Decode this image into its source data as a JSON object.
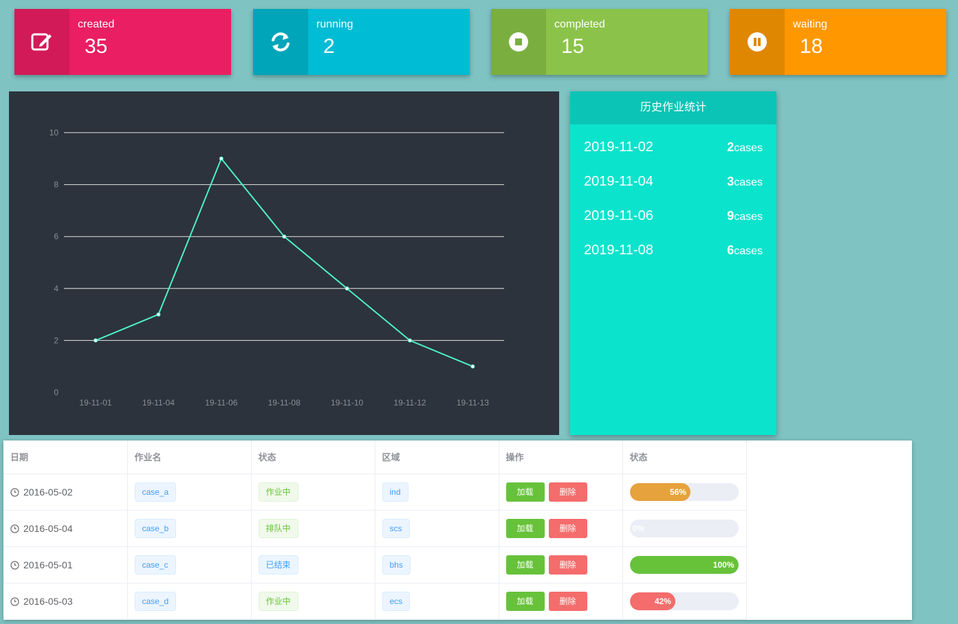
{
  "cards": [
    {
      "label": "created",
      "value": "35",
      "icon": "edit-icon",
      "color": "#ea1e63",
      "icon_bg": "#d21a58"
    },
    {
      "label": "running",
      "value": "2",
      "icon": "refresh-icon",
      "color": "#00bcd4",
      "icon_bg": "#00a5ba"
    },
    {
      "label": "completed",
      "value": "15",
      "icon": "stop-icon",
      "color": "#8bc34a",
      "icon_bg": "#7aaf40"
    },
    {
      "label": "waiting",
      "value": "18",
      "icon": "pause-icon",
      "color": "#ff9800",
      "icon_bg": "#e08700"
    }
  ],
  "chart_data": {
    "type": "line",
    "categories": [
      "19-11-01",
      "19-11-04",
      "19-11-06",
      "19-11-08",
      "19-11-10",
      "19-11-12",
      "19-11-13"
    ],
    "values": [
      2,
      3,
      9,
      6,
      4,
      2,
      1
    ],
    "yticks": [
      0,
      2,
      4,
      6,
      8,
      10
    ],
    "ylim": [
      0,
      10
    ],
    "line_color": "#4ef0c8",
    "grid": true
  },
  "history": {
    "title": "历史作业统计",
    "unit": "cases",
    "rows": [
      {
        "date": "2019-11-02",
        "count": "2"
      },
      {
        "date": "2019-11-04",
        "count": "3"
      },
      {
        "date": "2019-11-06",
        "count": "9"
      },
      {
        "date": "2019-11-08",
        "count": "6"
      }
    ]
  },
  "table": {
    "headers": [
      "日期",
      "作业名",
      "状态",
      "区域",
      "操作",
      "状态"
    ],
    "load_label": "加载",
    "delete_label": "删除",
    "rows": [
      {
        "date": "2016-05-02",
        "name": "case_a",
        "status": "作业中",
        "status_type": "green",
        "region": "ind",
        "progress": 56,
        "progress_label": "56%",
        "bar_color": "#e6a23c"
      },
      {
        "date": "2016-05-04",
        "name": "case_b",
        "status": "排队中",
        "status_type": "green",
        "region": "scs",
        "progress": 0,
        "progress_label": "0%",
        "bar_color": "#67c23a"
      },
      {
        "date": "2016-05-01",
        "name": "case_c",
        "status": "已结束",
        "status_type": "blue",
        "region": "bhs",
        "progress": 100,
        "progress_label": "100%",
        "bar_color": "#67c23a"
      },
      {
        "date": "2016-05-03",
        "name": "case_d",
        "status": "作业中",
        "status_type": "green",
        "region": "ecs",
        "progress": 42,
        "progress_label": "42%",
        "bar_color": "#f56c6c"
      }
    ]
  }
}
